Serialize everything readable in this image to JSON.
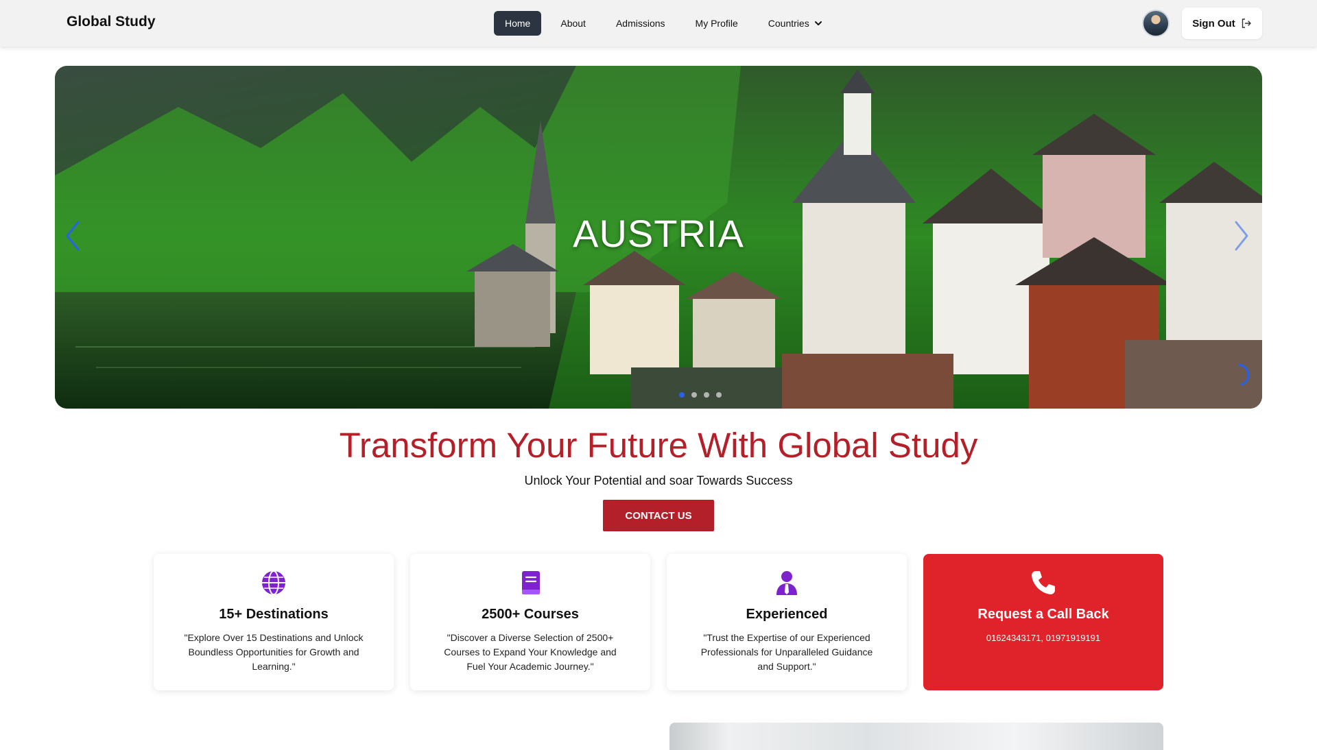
{
  "navbar": {
    "brand": "Global Study",
    "links": [
      {
        "label": "Home",
        "active": true
      },
      {
        "label": "About",
        "active": false
      },
      {
        "label": "Admissions",
        "active": false
      },
      {
        "label": "My Profile",
        "active": false
      }
    ],
    "dropdown_label": "Countries",
    "signout_label": "Sign Out"
  },
  "hero": {
    "slide_title": "AUSTRIA",
    "slide_count": 4,
    "active_slide": 1
  },
  "headline": {
    "title": "Transform Your Future With Global Study",
    "subtitle": "Unlock Your Potential and soar Towards Success",
    "button_label": "CONTACT US"
  },
  "cards": [
    {
      "icon": "globe-icon",
      "title": "15+ Destinations",
      "desc": "\"Explore Over 15 Destinations and Unlock Boundless Opportunities for Growth and Learning.\""
    },
    {
      "icon": "book-icon",
      "title": "2500+ Courses",
      "desc": "\"Discover a Diverse Selection of 2500+ Courses to Expand Your Knowledge and Fuel Your Academic Journey.\""
    },
    {
      "icon": "user-tie-icon",
      "title": "Experienced",
      "desc": "\"Trust the Expertise of our Experienced Professionals for Unparalleled Guidance and Support.\""
    },
    {
      "icon": "phone-icon",
      "title": "Request a Call Back",
      "desc": "01624343171, 01971919191"
    }
  ],
  "colors": {
    "brand_red": "#b3202a",
    "callback_red": "#e0232a",
    "icon_purple": "#7e22ce",
    "nav_active": "#2b3440",
    "arrow_blue": "#2563eb"
  }
}
